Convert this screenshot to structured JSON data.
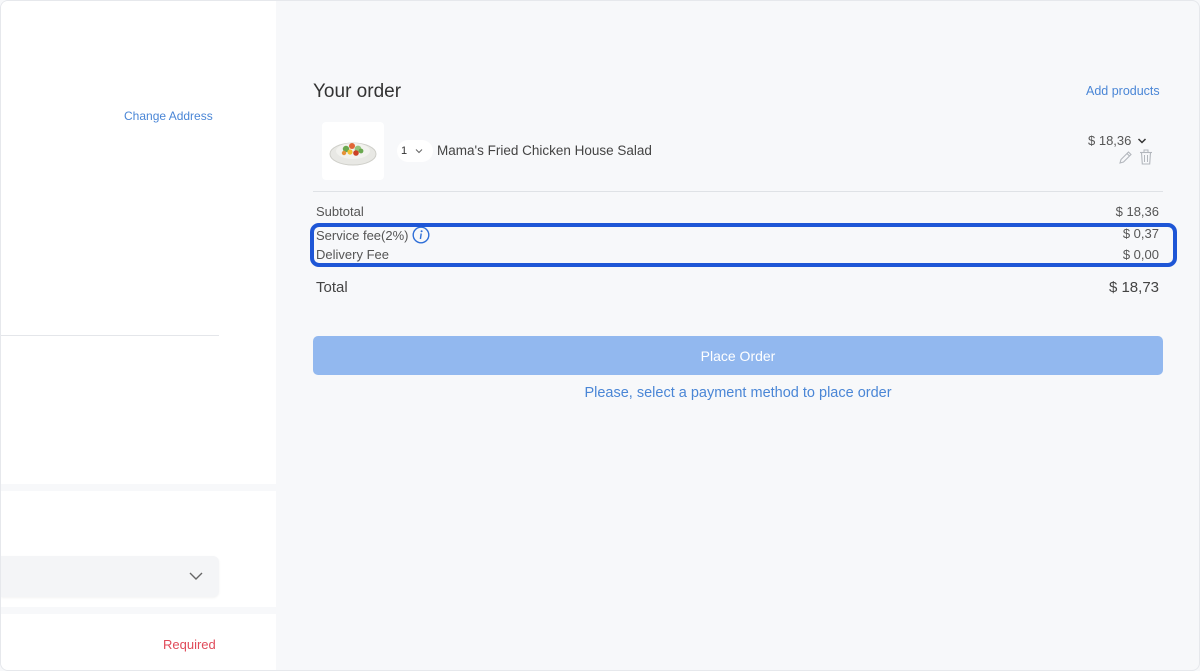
{
  "address": {
    "change_label": "Change Address"
  },
  "payment": {
    "required_label": "Required"
  },
  "order": {
    "title": "Your order",
    "add_products_label": "Add products",
    "items": [
      {
        "quantity": "1",
        "name": "Mama's Fried Chicken House Salad",
        "price": "$ 18,36"
      }
    ],
    "subtotal_label": "Subtotal",
    "subtotal_value": "$ 18,36",
    "service_fee_label": "Service fee(2%)",
    "service_fee_value": "$ 0,37",
    "delivery_fee_label": "Delivery Fee",
    "delivery_fee_value": "$ 0,00",
    "total_label": "Total",
    "total_value": "$ 18,73",
    "place_order_label": "Place Order",
    "payment_note": "Please, select a payment method to place order"
  },
  "colors": {
    "accent": "#4a86d6",
    "button_disabled": "#92b8ef",
    "highlight": "#1e56d6",
    "required": "#e04b5a"
  },
  "icons": [
    "chevron-down-icon",
    "pencil-icon",
    "trash-icon",
    "info-icon"
  ]
}
